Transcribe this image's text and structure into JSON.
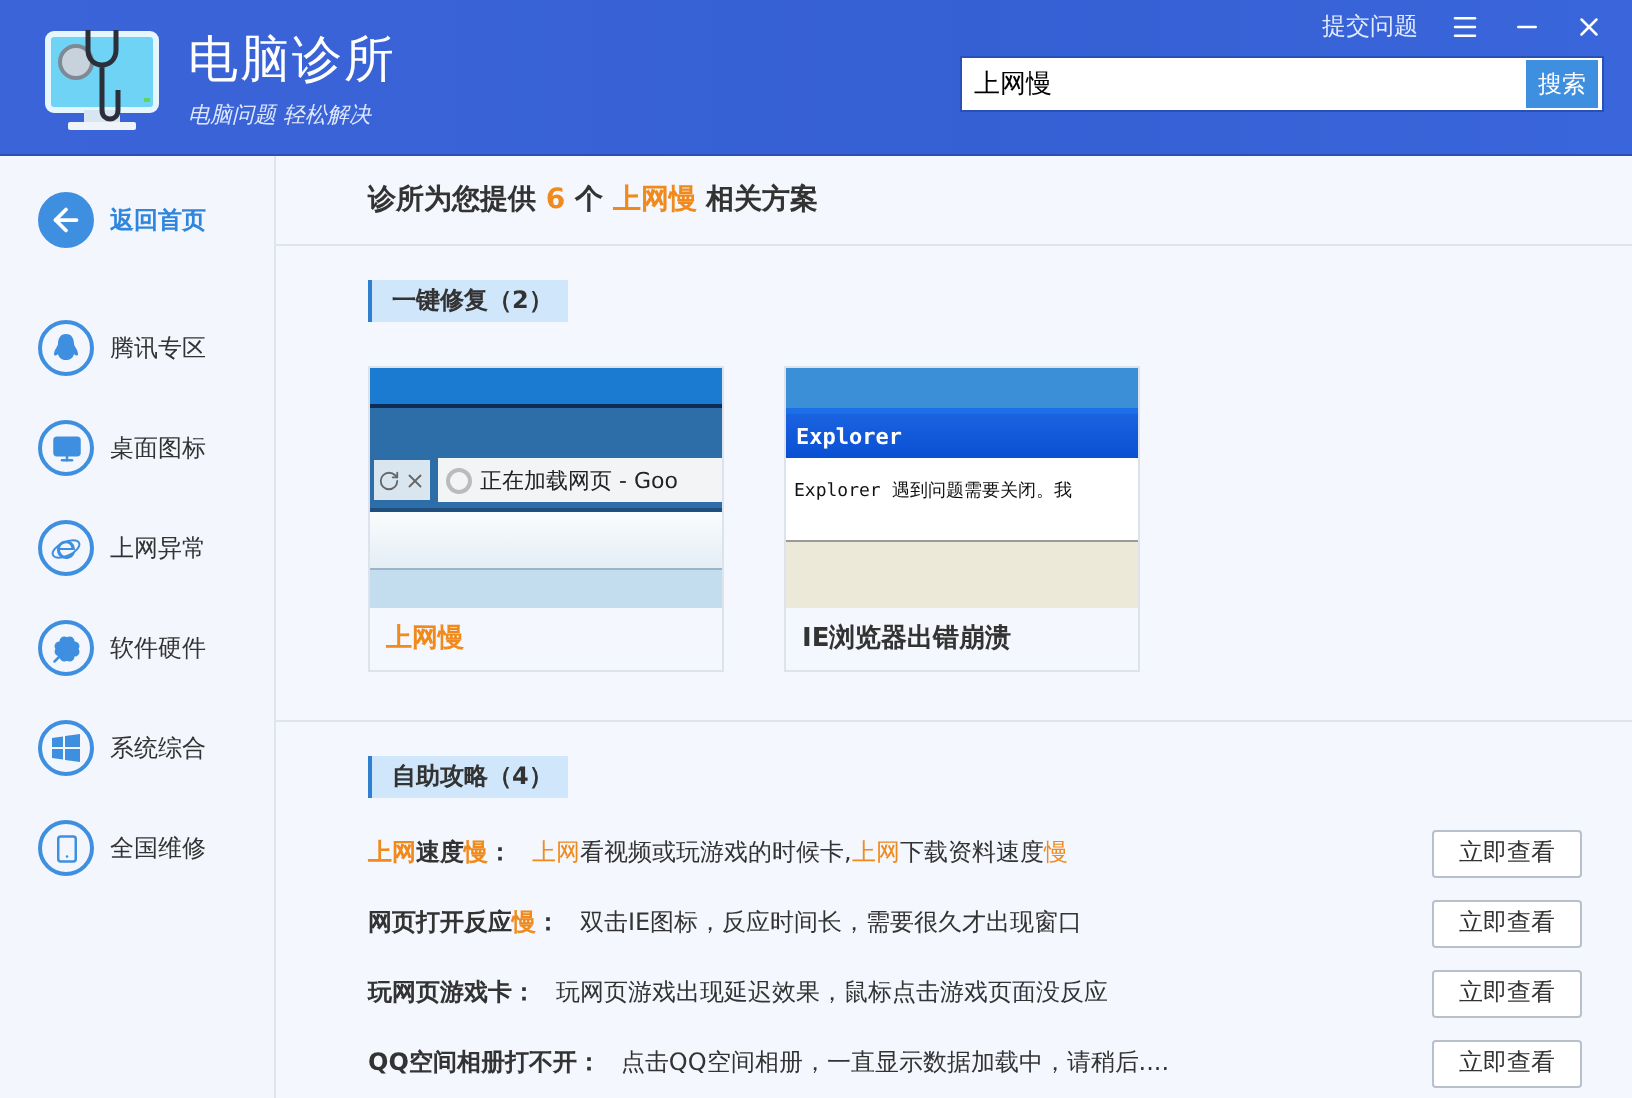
{
  "header": {
    "app_name": "电脑诊所",
    "slogan": "电脑问题 轻松解决",
    "feedback_link": "提交问题",
    "search": {
      "value": "上网慢",
      "button": "搜索"
    }
  },
  "sidebar": {
    "items": [
      {
        "label": "返回首页",
        "kind": "back",
        "selected": true
      },
      {
        "label": "腾讯专区",
        "kind": "penguin",
        "selected": false
      },
      {
        "label": "桌面图标",
        "kind": "monitor",
        "selected": false
      },
      {
        "label": "上网异常",
        "kind": "browser",
        "selected": false
      },
      {
        "label": "软件硬件",
        "kind": "clover",
        "selected": false
      },
      {
        "label": "系统综合",
        "kind": "windows",
        "selected": false
      },
      {
        "label": "全国维修",
        "kind": "phone",
        "selected": false
      }
    ]
  },
  "summary": [
    {
      "text": "诊所为您提供 ",
      "highlight": false
    },
    {
      "text": "6",
      "highlight": true
    },
    {
      "text": " 个 ",
      "highlight": false
    },
    {
      "text": "上网慢",
      "highlight": true
    },
    {
      "text": " 相关方案",
      "highlight": false
    }
  ],
  "quick_fix": {
    "heading": "一键修复（2）",
    "cards": [
      {
        "kind": "loading",
        "title": "上网慢",
        "highlight": true,
        "screen_texts": [
          "正在加载网页 - Goo"
        ]
      },
      {
        "kind": "crash",
        "title": "IE浏览器出错崩溃",
        "highlight": false,
        "screen_texts": [
          "Explorer",
          "Explorer 遇到问题需要关闭。我"
        ]
      }
    ]
  },
  "guides": {
    "heading": "自助攻略（4）",
    "items": [
      {
        "title": [
          {
            "text": "上网",
            "highlight": true
          },
          {
            "text": "速度",
            "highlight": false
          },
          {
            "text": "慢",
            "highlight": true
          },
          {
            "text": "：",
            "highlight": false
          }
        ],
        "description": [
          {
            "text": "上网",
            "highlight": true
          },
          {
            "text": "看视频或玩游戏的时候卡,",
            "highlight": false
          },
          {
            "text": "上网",
            "highlight": true
          },
          {
            "text": "下载资料速度",
            "highlight": false
          },
          {
            "text": "慢",
            "highlight": true
          }
        ],
        "button": "立即查看"
      },
      {
        "title": [
          {
            "text": "网页打开反应",
            "highlight": false
          },
          {
            "text": "慢",
            "highlight": true
          },
          {
            "text": "：",
            "highlight": false
          }
        ],
        "description": [
          {
            "text": "双击IE图标，反应时间长，需要很久才出现窗口",
            "highlight": false
          }
        ],
        "button": "立即查看"
      },
      {
        "title": [
          {
            "text": "玩网页游戏卡：",
            "highlight": false
          }
        ],
        "description": [
          {
            "text": "玩网页游戏出现延迟效果，鼠标点击游戏页面没反应",
            "highlight": false
          }
        ],
        "button": "立即查看"
      },
      {
        "title": [
          {
            "text": "QQ空间相册打不开：",
            "highlight": false
          }
        ],
        "description": [
          {
            "text": "点击QQ空间相册，一直显示数据加载中，请稍后....",
            "highlight": false
          }
        ],
        "button": "立即查看"
      }
    ]
  }
}
